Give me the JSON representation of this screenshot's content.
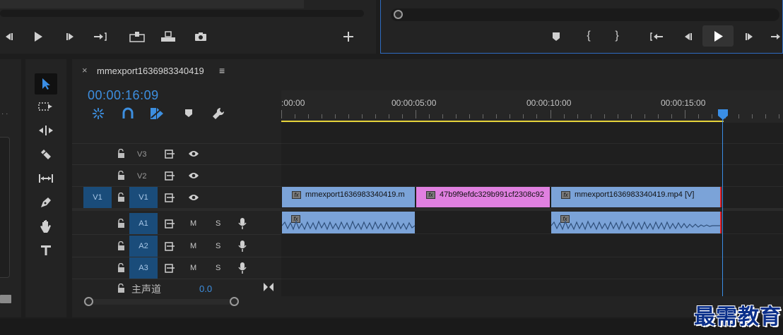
{
  "sequence": {
    "title": "mmexport1636983340419",
    "menu_icon": "≡",
    "close_icon": "×",
    "timecode": "00:00:16:09"
  },
  "ruler": {
    "labels": [
      ":00:00",
      "00:00:05:00",
      "00:00:10:00",
      "00:00:15:00"
    ]
  },
  "video_tracks": [
    {
      "name": "V3",
      "source": ""
    },
    {
      "name": "V2",
      "source": ""
    },
    {
      "name": "V1",
      "source": "V1"
    }
  ],
  "audio_tracks": [
    {
      "name": "A1",
      "mute": "M",
      "solo": "S"
    },
    {
      "name": "A2",
      "mute": "M",
      "solo": "S"
    },
    {
      "name": "A3",
      "mute": "M",
      "solo": "S"
    }
  ],
  "master": {
    "name": "主声道",
    "value": "0.0"
  },
  "video_clips": [
    {
      "name": "mmexport1636983340419.m",
      "color": "#7ba3d8"
    },
    {
      "name": "47b9f9efdc329b991cf2308c92",
      "color": "#e080e0"
    },
    {
      "name": "mmexport1636983340419.mp4 [V]",
      "color": "#7ba3d8"
    }
  ],
  "colors": {
    "accent_blue": "#3d8fe0",
    "playhead": "#3a8ee6",
    "work_area": "#e6d43a",
    "track_blue": "#1a4c7a",
    "audio_clip": "#7ba3d8",
    "video_clip": "#7ba3d8",
    "pink_clip": "#e080e0"
  },
  "watermark": "最需教育"
}
